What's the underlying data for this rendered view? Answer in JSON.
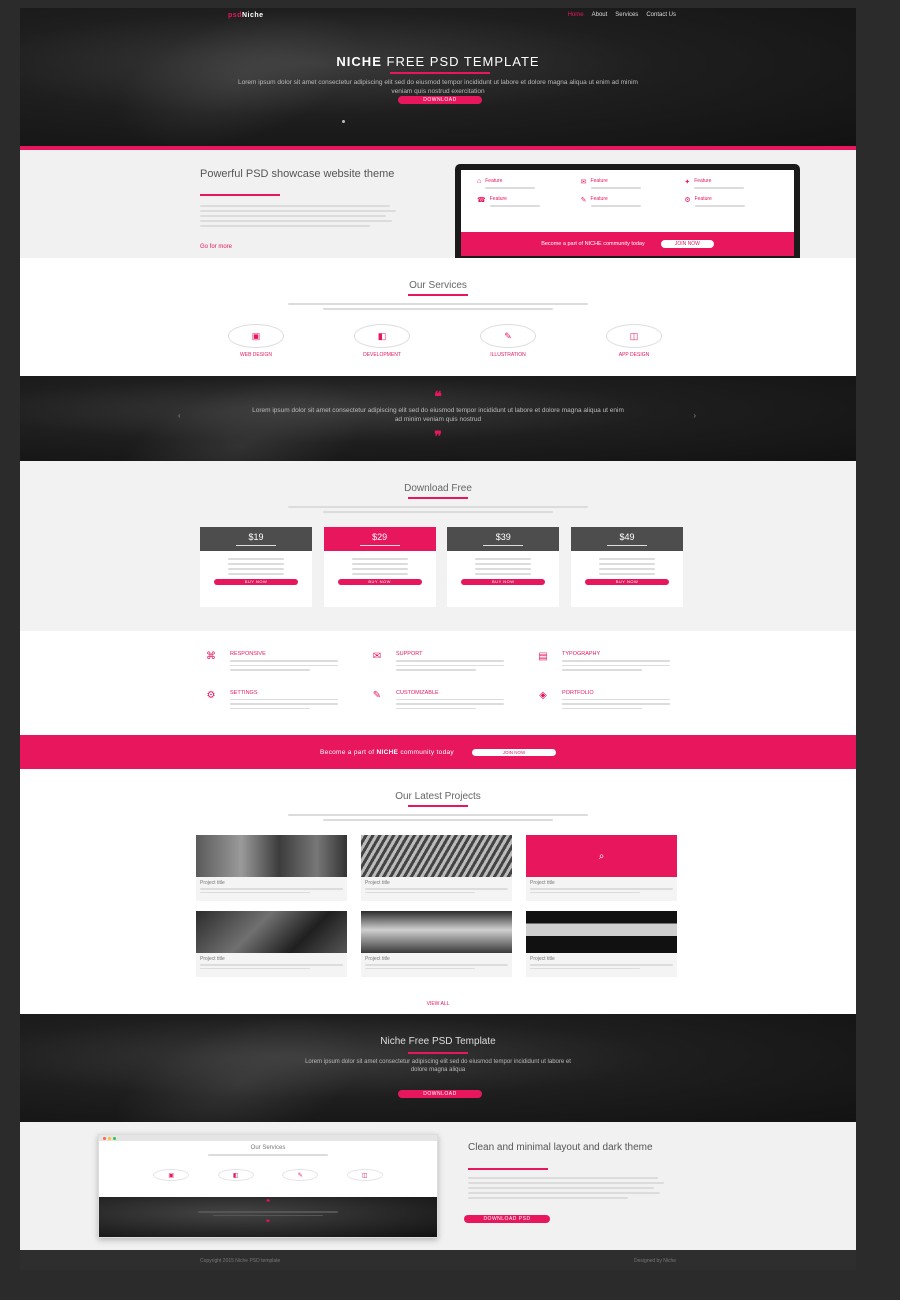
{
  "header": {
    "logo_prefix": "psd",
    "logo_name": "Niche",
    "nav": [
      "Home",
      "About",
      "Services",
      "Contact Us"
    ]
  },
  "hero": {
    "title_bold": "NICHE",
    "title_rest": "FREE PSD TEMPLATE",
    "subtitle": "Lorem ipsum dolor sit amet consectetur adipiscing elit sed do eiusmod tempor incididunt ut labore et dolore magna aliqua ut enim ad minim veniam quis nostrud exercitation",
    "button": "Download"
  },
  "powerful": {
    "title": "Powerful PSD showcase website theme",
    "more": "Go for more"
  },
  "laptop": {
    "cells": [
      {
        "icon": "⌂",
        "label": "Feature"
      },
      {
        "icon": "✉",
        "label": "Feature"
      },
      {
        "icon": "✦",
        "label": "Feature"
      },
      {
        "icon": "☎",
        "label": "Feature"
      },
      {
        "icon": "✎",
        "label": "Feature"
      },
      {
        "icon": "⚙",
        "label": "Feature"
      }
    ],
    "strip_text": "Become a part of NICHE community today",
    "strip_button": "Join now"
  },
  "services": {
    "title": "Our Services",
    "items": [
      {
        "icon": "▣",
        "label": "Web Design"
      },
      {
        "icon": "◧",
        "label": "Development"
      },
      {
        "icon": "✎",
        "label": "Illustration"
      },
      {
        "icon": "◫",
        "label": "App Design"
      }
    ]
  },
  "quote": {
    "open": "❝",
    "close": "❞",
    "text": "Lorem ipsum dolor sit amet consectetur adipiscing elit sed do eiusmod tempor incididunt ut labore et dolore magna aliqua ut enim ad minim veniam quis nostrud"
  },
  "download": {
    "title": "Download Free",
    "plans": [
      {
        "price": "$19",
        "button": "Buy now",
        "highlight": false
      },
      {
        "price": "$29",
        "button": "Buy now",
        "highlight": true
      },
      {
        "price": "$39",
        "button": "Buy now",
        "highlight": false
      },
      {
        "price": "$49",
        "button": "Buy now",
        "highlight": false
      }
    ]
  },
  "features": [
    {
      "icon": "⌘",
      "title": "Responsive"
    },
    {
      "icon": "✉",
      "title": "Support"
    },
    {
      "icon": "▤",
      "title": "Typography"
    },
    {
      "icon": "⚙",
      "title": "Settings"
    },
    {
      "icon": "✎",
      "title": "Customizable"
    },
    {
      "icon": "◈",
      "title": "Portfolio"
    }
  ],
  "band": {
    "text_pre": "Become a part of",
    "text_bold": "NICHE",
    "text_post": "community today",
    "button": "Join now"
  },
  "projects": {
    "title": "Our Latest Projects",
    "view_all": "View all",
    "items": [
      {
        "title": "Project title",
        "icon": ""
      },
      {
        "title": "Project title",
        "icon": ""
      },
      {
        "title": "Project title",
        "icon": "⌕"
      },
      {
        "title": "Project title",
        "icon": ""
      },
      {
        "title": "Project title",
        "icon": ""
      },
      {
        "title": "Project title",
        "icon": ""
      }
    ]
  },
  "niche": {
    "title": "Niche Free PSD Template",
    "subtitle": "Lorem ipsum dolor sit amet consectetur adipiscing elit sed do eiusmod tempor incididunt ut labore et dolore magna aliqua",
    "button": "Download"
  },
  "showcase": {
    "mini_title": "Our Services",
    "title": "Clean and minimal layout and dark theme",
    "button": "Download PSD"
  },
  "footer": {
    "left": "Copyright 2015 Niche PSD template",
    "right": "Designed by Niche"
  },
  "colors": {
    "accent": "#e8175d",
    "dark": "#1b1b1b",
    "light_section": "#f1f1f1",
    "outer": "#2b2b2b"
  }
}
